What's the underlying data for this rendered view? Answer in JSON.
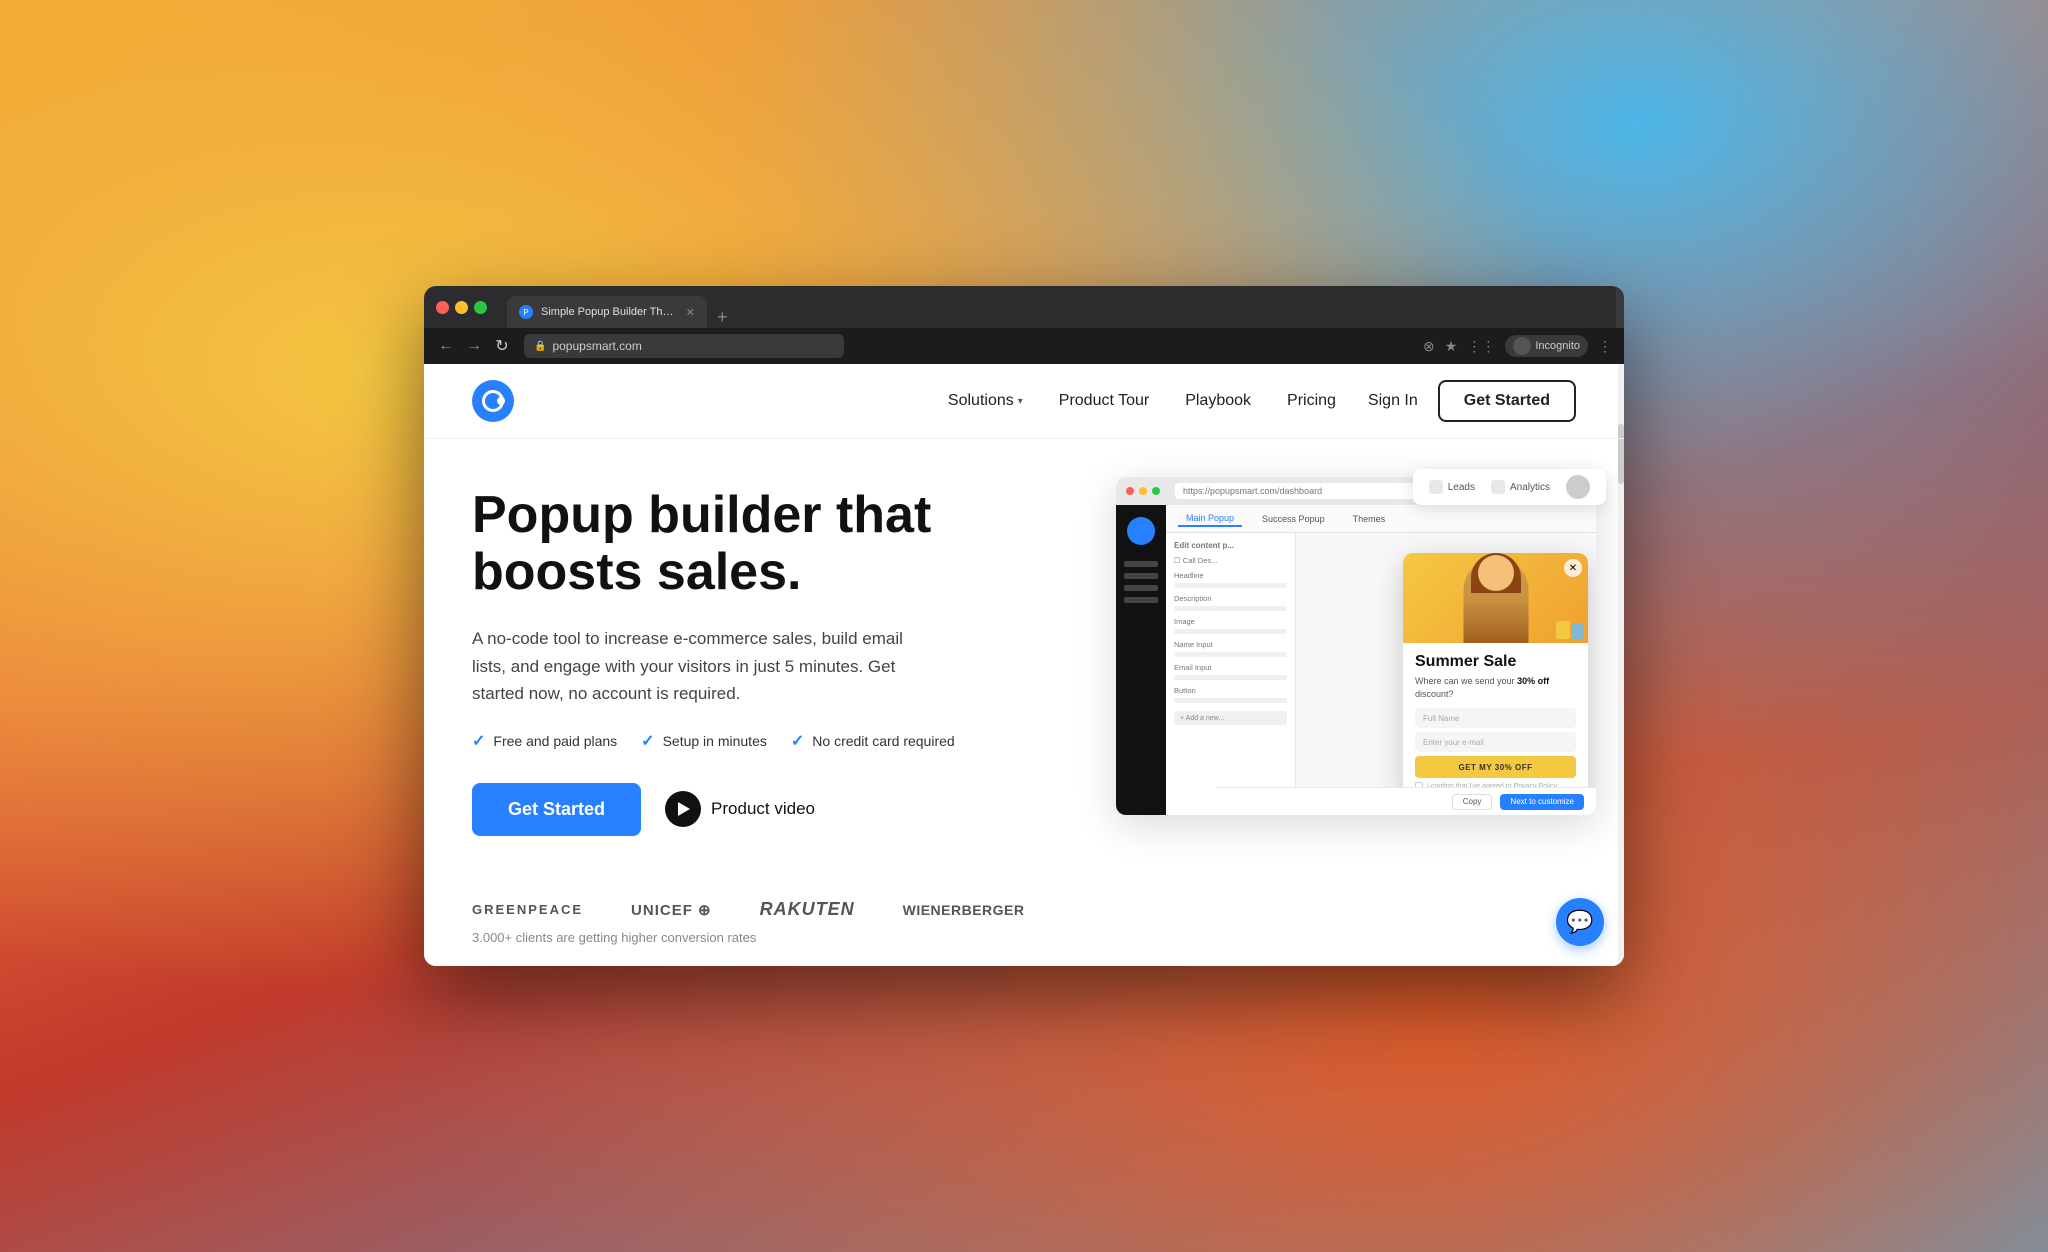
{
  "browser": {
    "tab_title": "Simple Popup Builder That Bo...",
    "url": "popupsmart.com",
    "new_tab_button": "+",
    "incognito_label": "Incognito",
    "back_disabled": false,
    "forward_disabled": true
  },
  "nav": {
    "logo_alt": "Popupsmart Logo",
    "solutions_label": "Solutions",
    "product_tour_label": "Product Tour",
    "playbook_label": "Playbook",
    "pricing_label": "Pricing",
    "signin_label": "Sign In",
    "cta_label": "Get Started"
  },
  "hero": {
    "title": "Popup builder that boosts sales.",
    "subtitle": "A no-code tool to increase e-commerce sales, build email lists, and engage with your visitors in just 5 minutes. Get started now, no account is required.",
    "check1": "Free and paid plans",
    "check2": "Setup in minutes",
    "check3": "No credit card required",
    "cta_label": "Get Started",
    "video_label": "Product video"
  },
  "logos": {
    "brands": [
      "GREENPEACE",
      "unicef",
      "Rakuten",
      "wienerberger"
    ],
    "clients_text": "3.000+ clients are getting higher conversion rates"
  },
  "mockup": {
    "address": "https://popupsmart.com/dashboard",
    "tabs": [
      "Main Popup",
      "Success Popup",
      "Themes"
    ],
    "active_tab": "Main Popup",
    "topbar_leads": "Leads",
    "topbar_analytics": "Analytics",
    "fields": [
      "Headline",
      "Description",
      "Image",
      "Name Input",
      "Email Input",
      "Button"
    ],
    "popup": {
      "title": "Summer Sale",
      "desc_text": "Where can we send your ",
      "desc_bold": "30% off",
      "desc_end": " discount?",
      "full_name_placeholder": "Full Name",
      "email_placeholder": "Enter your e-mail",
      "cta_btn": "GET MY 30% OFF",
      "disclaimer": "I confirm that I've agreed to Privacy Policy."
    },
    "bottom_buttons": [
      "Copy",
      "Next to customize"
    ]
  },
  "chat": {
    "icon": "💬"
  }
}
